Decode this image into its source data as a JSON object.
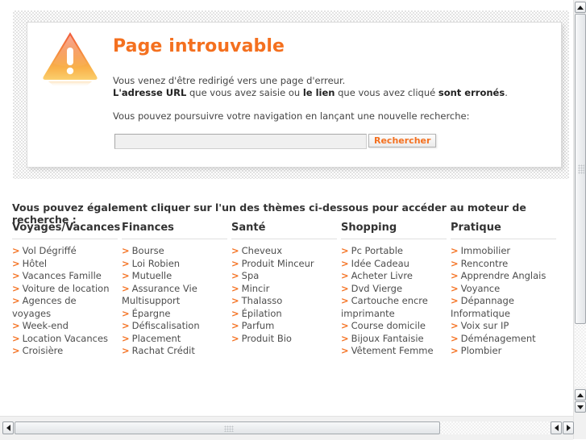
{
  "error": {
    "icon": "warning-triangle-icon",
    "title": "Page introuvable",
    "body_line1": "Vous venez d'être redirigé vers une page d'erreur.",
    "body_line2_a": "L'adresse URL",
    "body_line2_b": " que vous avez saisie ou ",
    "body_line2_c": "le lien",
    "body_line2_d": " que vous avez cliqué ",
    "body_line2_e": "sont erronés",
    "body_line2_f": ".",
    "subtext": "Vous pouvez poursuivre votre navigation en lançant une nouvelle recherche:",
    "search_value": "",
    "search_placeholder": "",
    "search_button": "Rechercher"
  },
  "themes": {
    "heading": "Vous pouvez également cliquer sur l'un des thèmes ci-dessous pour accéder au moteur de recherche :",
    "arrow": ">",
    "columns": [
      {
        "title": "Voyages/Vacances",
        "links": [
          "Vol Dégriffé",
          "Hôtel",
          "Vacances Famille",
          "Voiture de location",
          "Agences de voyages",
          "Week-end",
          "Location Vacances",
          "Croisière"
        ]
      },
      {
        "title": "Finances",
        "links": [
          "Bourse",
          "Loi Robien",
          "Mutuelle",
          "Assurance Vie Multisupport",
          "Épargne",
          "Défiscalisation",
          "Placement",
          "Rachat Crédit"
        ]
      },
      {
        "title": "Santé",
        "links": [
          "Cheveux",
          "Produit Minceur",
          "Spa",
          "Mincir",
          "Thalasso",
          "Épilation",
          "Parfum",
          "Produit Bio"
        ]
      },
      {
        "title": "Shopping",
        "links": [
          "Pc Portable",
          "Idée Cadeau",
          "Acheter Livre",
          "Dvd Vierge",
          "Cartouche encre imprimante",
          "Course domicile",
          "Bijoux Fantaisie",
          "Vêtement Femme"
        ]
      },
      {
        "title": "Pratique",
        "links": [
          "Immobilier",
          "Rencontre",
          "Apprendre Anglais",
          "Voyance",
          "Dépannage Informatique",
          "Voix sur IP",
          "Déménagement",
          "Plombier"
        ]
      }
    ]
  },
  "colors": {
    "accent": "#f4701f",
    "text": "#4d4d4d",
    "heading": "#333333"
  },
  "scrollbars": {
    "vertical": {
      "up_icon": "triangle-up-icon",
      "down_icon": "triangle-down-icon"
    },
    "horizontal": {
      "left_icon": "triangle-left-icon",
      "right_icon": "triangle-right-icon"
    }
  }
}
